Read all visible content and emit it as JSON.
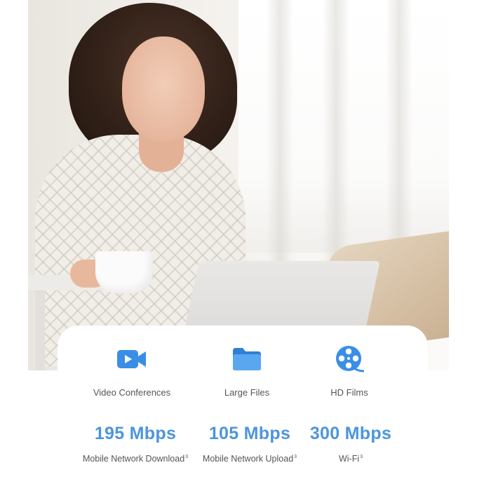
{
  "hero": {
    "image_alt": "Woman smiling at laptop holding a coffee cup"
  },
  "features": [
    {
      "icon": "video-camera-icon",
      "label": "Video Conferences"
    },
    {
      "icon": "folder-icon",
      "label": "Large Files"
    },
    {
      "icon": "film-reel-icon",
      "label": "HD Films"
    }
  ],
  "stats": [
    {
      "value": "195 Mbps",
      "caption": "Mobile Network Download",
      "footnote": "3"
    },
    {
      "value": "105 Mbps",
      "caption": "Mobile Network Upload",
      "footnote": "3"
    },
    {
      "value": "300 Mbps",
      "caption": "Wi-Fi",
      "footnote": "3"
    }
  ],
  "colors": {
    "accent_blue": "#4c95dd",
    "icon_blue": "#3a8ee6",
    "text_gray": "#555555"
  }
}
